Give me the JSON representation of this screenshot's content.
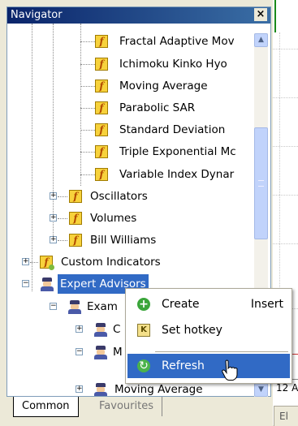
{
  "navigator": {
    "title": "Navigator",
    "close": "×",
    "indicators": [
      "Fractal Adaptive Mov",
      "Ichimoku Kinko Hyo",
      "Moving Average",
      "Parabolic SAR",
      "Standard Deviation",
      "Triple Exponential Mc",
      "Variable Index Dynar"
    ],
    "groups": [
      "Oscillators",
      "Volumes",
      "Bill Williams"
    ],
    "custom_indicators": "Custom Indicators",
    "expert_advisors": "Expert Advisors",
    "examples": "Exam",
    "sub_c": "C",
    "sub_m": "M",
    "moving_average_ea": "Moving Average",
    "icon_f": "f",
    "icon_k": "K",
    "plus": "+",
    "minus": "−"
  },
  "tabs": {
    "common": "Common",
    "favourites": "Favourites"
  },
  "context_menu": {
    "create": "Create",
    "create_shortcut": "Insert",
    "set_hotkey": "Set hotkey",
    "refresh": "Refresh"
  },
  "chart": {
    "time_label": "12 A",
    "status_label": "El"
  },
  "scrollbar": {
    "up": "▲",
    "down": "▼",
    "position_fraction": 0.26
  },
  "icons": {
    "indicator": "indicator-icon",
    "expert": "expert-advisor-icon",
    "create": "plus-circle-icon",
    "hotkey": "hotkey-icon",
    "refresh": "refresh-icon"
  }
}
